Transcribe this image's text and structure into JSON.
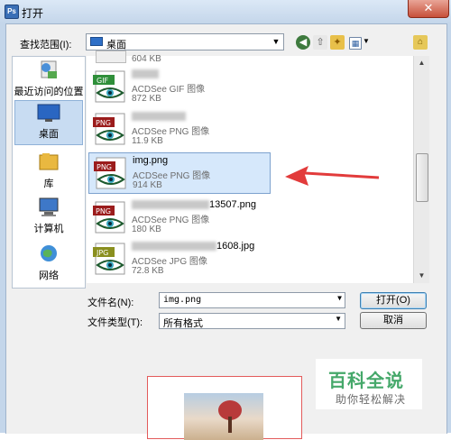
{
  "window": {
    "title": "打开",
    "close": "✕",
    "app_icon": "Ps"
  },
  "lookin": {
    "label": "查找范围(I):",
    "value": "桌面"
  },
  "sidebar": {
    "items": [
      {
        "label": "最近访问的位置",
        "icon": "recent-places-icon"
      },
      {
        "label": "桌面",
        "icon": "desktop-icon",
        "selected": true
      },
      {
        "label": "库",
        "icon": "libraries-icon"
      },
      {
        "label": "计算机",
        "icon": "computer-icon"
      },
      {
        "label": "网络",
        "icon": "network-icon"
      }
    ]
  },
  "files": [
    {
      "name_suffix": "",
      "type": "",
      "size": "604 KB",
      "badge": ""
    },
    {
      "name_suffix": "",
      "type": "ACDSee GIF 图像",
      "size": "872 KB",
      "badge": "GIF",
      "badge_color": "#2f8f3a"
    },
    {
      "name_suffix": "",
      "type": "ACDSee PNG 图像",
      "size": "11.9 KB",
      "badge": "PNG",
      "badge_color": "#9b1c1c"
    },
    {
      "name": "img.png",
      "type": "ACDSee PNG 图像",
      "size": "914 KB",
      "badge": "PNG",
      "badge_color": "#9b1c1c",
      "selected": true
    },
    {
      "name_suffix": "13507.png",
      "type": "ACDSee PNG 图像",
      "size": "180 KB",
      "badge": "PNG",
      "badge_color": "#9b1c1c"
    },
    {
      "name_suffix": "1608.jpg",
      "type": "ACDSee JPG 图像",
      "size": "72.8 KB",
      "badge": "JPG",
      "badge_color": "#8a8f1f"
    }
  ],
  "filename": {
    "label": "文件名(N):",
    "value": "img.png"
  },
  "filetype": {
    "label": "文件类型(T):",
    "value": "所有格式"
  },
  "buttons": {
    "open": "打开(O)",
    "cancel": "取消"
  },
  "watermark": {
    "title": "百科全说",
    "subtitle": "助你轻松解决"
  },
  "colors": {
    "accent_arrow": "#e23b3b",
    "selection": "#d6e8fb"
  }
}
